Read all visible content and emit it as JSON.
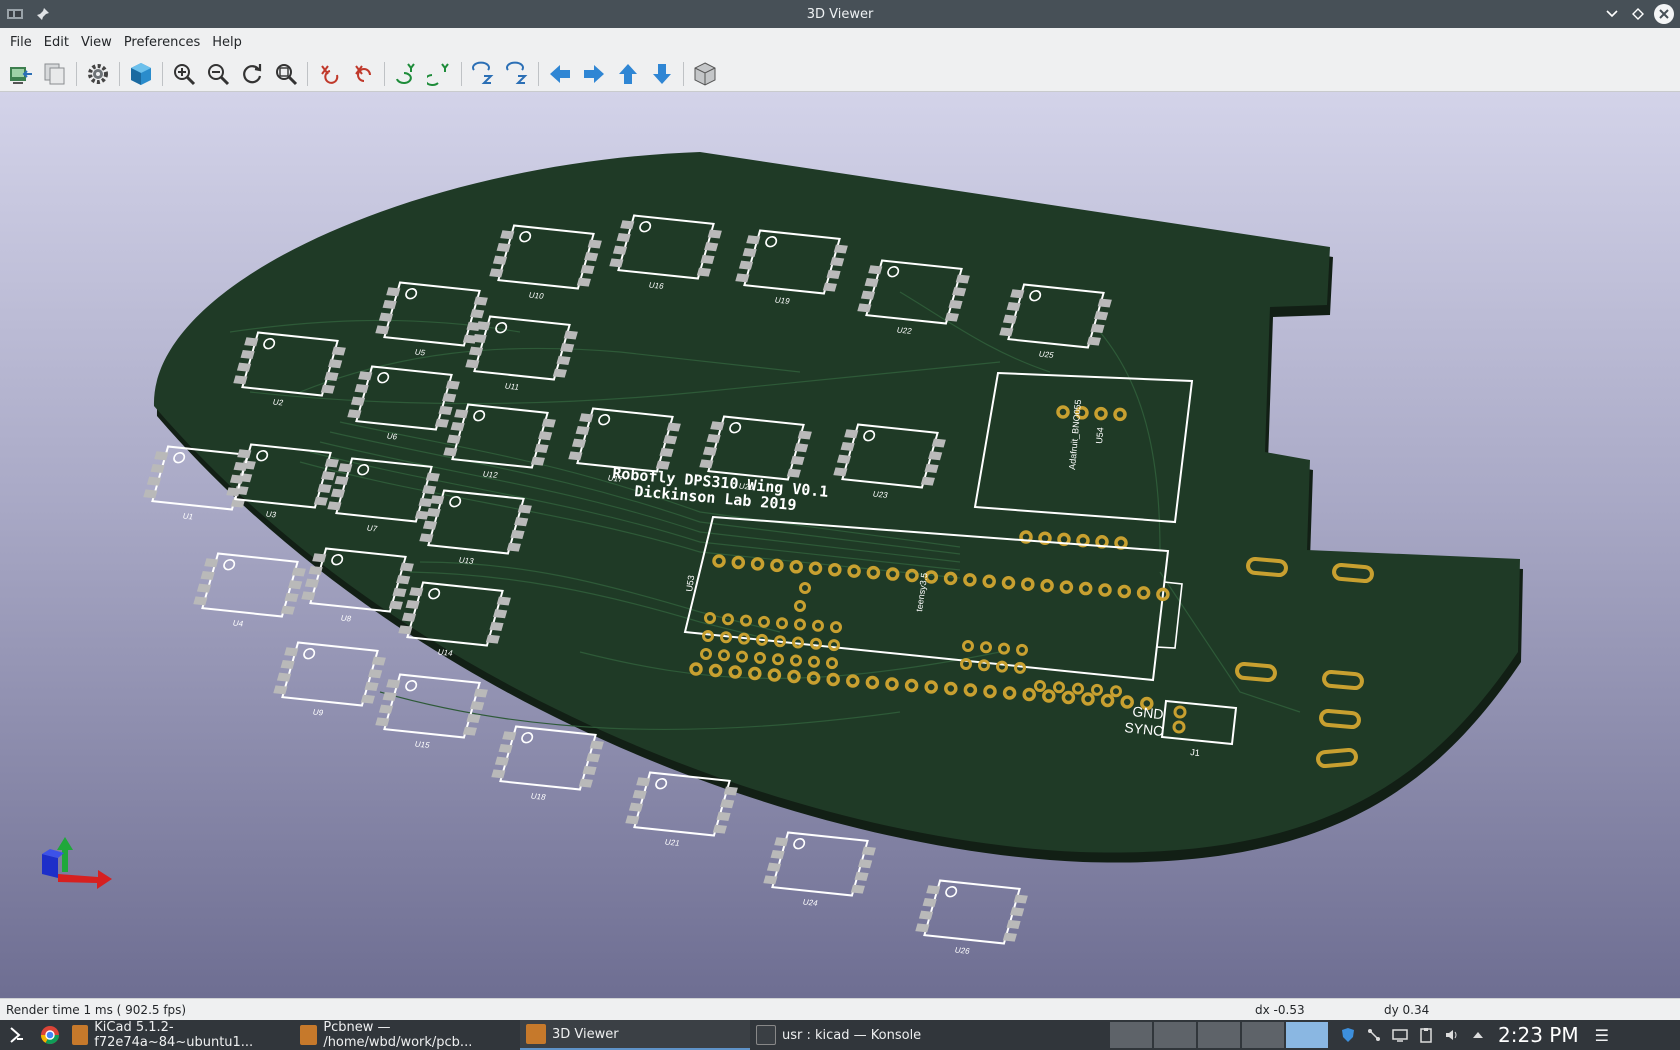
{
  "window": {
    "title": "3D Viewer"
  },
  "menu": [
    "File",
    "Edit",
    "View",
    "Preferences",
    "Help"
  ],
  "toolbar": {
    "buttons": [
      "copy-to-clipboard",
      "copy-image",
      "settings",
      "raytracing",
      "zoom-in",
      "zoom-out",
      "redraw",
      "zoom-fit",
      "rotate-x-cw",
      "rotate-x-ccw",
      "rotate-y-cw",
      "rotate-y-ccw",
      "rotate-z-cw",
      "rotate-z-ccw",
      "move-left",
      "move-right",
      "move-up",
      "move-down",
      "ortho"
    ]
  },
  "board": {
    "title_line1": "Robofly DPS310 Wing V0.1",
    "title_line2": "Dickinson Lab 2019",
    "components": [
      "U1",
      "U2",
      "U3",
      "U4",
      "U5",
      "U6",
      "U7",
      "U8",
      "U9",
      "U10",
      "U11",
      "U12",
      "U13",
      "U14",
      "U15",
      "U16",
      "U17",
      "U18",
      "U19",
      "U20",
      "U21",
      "U22",
      "U23",
      "U24",
      "U25",
      "U26"
    ],
    "module_label": "Adafruit_BNO055",
    "module_ref": "U54",
    "teensy_label": "teensy3.5",
    "teensy_ref": "U53",
    "connector_ref": "J1",
    "connector_pins": [
      "GND",
      "SYNC"
    ]
  },
  "status": {
    "render": "Render time 1 ms ( 902.5 fps)",
    "dx": "dx -0.53",
    "dy": "dy 0.34"
  },
  "taskbar": {
    "tasks": [
      {
        "label": "KiCad 5.1.2-f72e74a~84~ubuntu1...",
        "icon": "kicad-icon"
      },
      {
        "label": "Pcbnew — /home/wbd/work/pcb...",
        "icon": "pcbnew-icon"
      },
      {
        "label": "3D Viewer",
        "icon": "viewer-icon"
      },
      {
        "label": "usr : kicad — Konsole",
        "icon": "konsole-icon"
      }
    ],
    "clock": "2:23 PM"
  },
  "colors": {
    "board": "#1f3a26",
    "silk": "#ffffff",
    "pad": "#c8a030",
    "titlebar": "#475057"
  }
}
